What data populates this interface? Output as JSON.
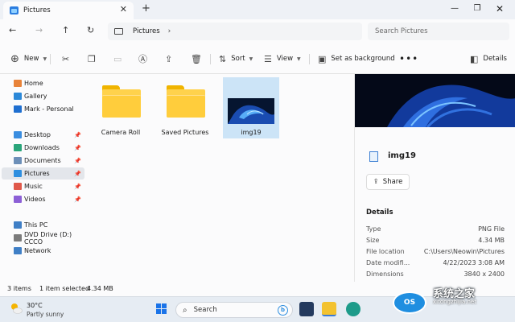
{
  "window": {
    "tab_title": "Pictures",
    "close_tab_glyph": "✕",
    "new_tab_glyph": "+",
    "minimize_glyph": "—",
    "maximize_glyph": "❐",
    "close_glyph": "✕"
  },
  "address": {
    "crumbs": [
      "Pictures"
    ],
    "search_placeholder": "Search Pictures"
  },
  "toolbar": {
    "new_label": "New",
    "sort_label": "Sort",
    "view_label": "View",
    "background_label": "Set as background",
    "more_label": "•••",
    "details_label": "Details"
  },
  "sidebar": {
    "items": [
      {
        "label": "Home",
        "icon": "home-icon",
        "color": "#e8833a"
      },
      {
        "label": "Gallery",
        "icon": "gallery-icon",
        "color": "#2b88d8"
      },
      {
        "label": "Mark - Personal",
        "icon": "onedrive-icon",
        "color": "#1f6fd0"
      },
      {
        "label": "Desktop",
        "icon": "desktop-icon",
        "color": "#3a8de0",
        "pinned": true
      },
      {
        "label": "Downloads",
        "icon": "downloads-icon",
        "color": "#2aa57a",
        "pinned": true
      },
      {
        "label": "Documents",
        "icon": "documents-icon",
        "color": "#6c8fb8",
        "pinned": true
      },
      {
        "label": "Pictures",
        "icon": "pictures-icon",
        "color": "#2f8fe0",
        "pinned": true,
        "selected": true
      },
      {
        "label": "Music",
        "icon": "music-icon",
        "color": "#e0584a",
        "pinned": true
      },
      {
        "label": "Videos",
        "icon": "videos-icon",
        "color": "#8c5fd6",
        "pinned": true
      },
      {
        "label": "This PC",
        "icon": "this-pc-icon",
        "color": "#3f7fc6"
      },
      {
        "label": "DVD Drive (D:) CCCO",
        "icon": "dvd-drive-icon",
        "color": "#7b7b7b"
      },
      {
        "label": "Network",
        "icon": "network-icon",
        "color": "#3f7fc6"
      }
    ]
  },
  "files": [
    {
      "name": "Camera Roll",
      "type": "folder"
    },
    {
      "name": "Saved Pictures",
      "type": "folder"
    },
    {
      "name": "img19",
      "type": "image",
      "selected": true
    }
  ],
  "details_pane": {
    "filename": "img19",
    "share_label": "Share",
    "section_title": "Details",
    "properties": [
      {
        "key": "Type",
        "value": "PNG File"
      },
      {
        "key": "Size",
        "value": "4.34 MB"
      },
      {
        "key": "File location",
        "value": "C:\\Users\\Neowin\\Pictures"
      },
      {
        "key": "Date modifi...",
        "value": "4/22/2023 3:08 AM"
      },
      {
        "key": "Dimensions",
        "value": "3840 x 2400"
      }
    ]
  },
  "status": {
    "item_count": "3 items",
    "selection": "1 item selected",
    "selection_size": "4.34 MB"
  },
  "taskbar": {
    "temperature": "30°C",
    "condition": "Partly sunny",
    "search_label": "Search",
    "copilot_glyph": "b"
  },
  "watermark": {
    "title": "系统之家",
    "subtitle": "xitongzhijia.net",
    "logo_text": "OS"
  }
}
